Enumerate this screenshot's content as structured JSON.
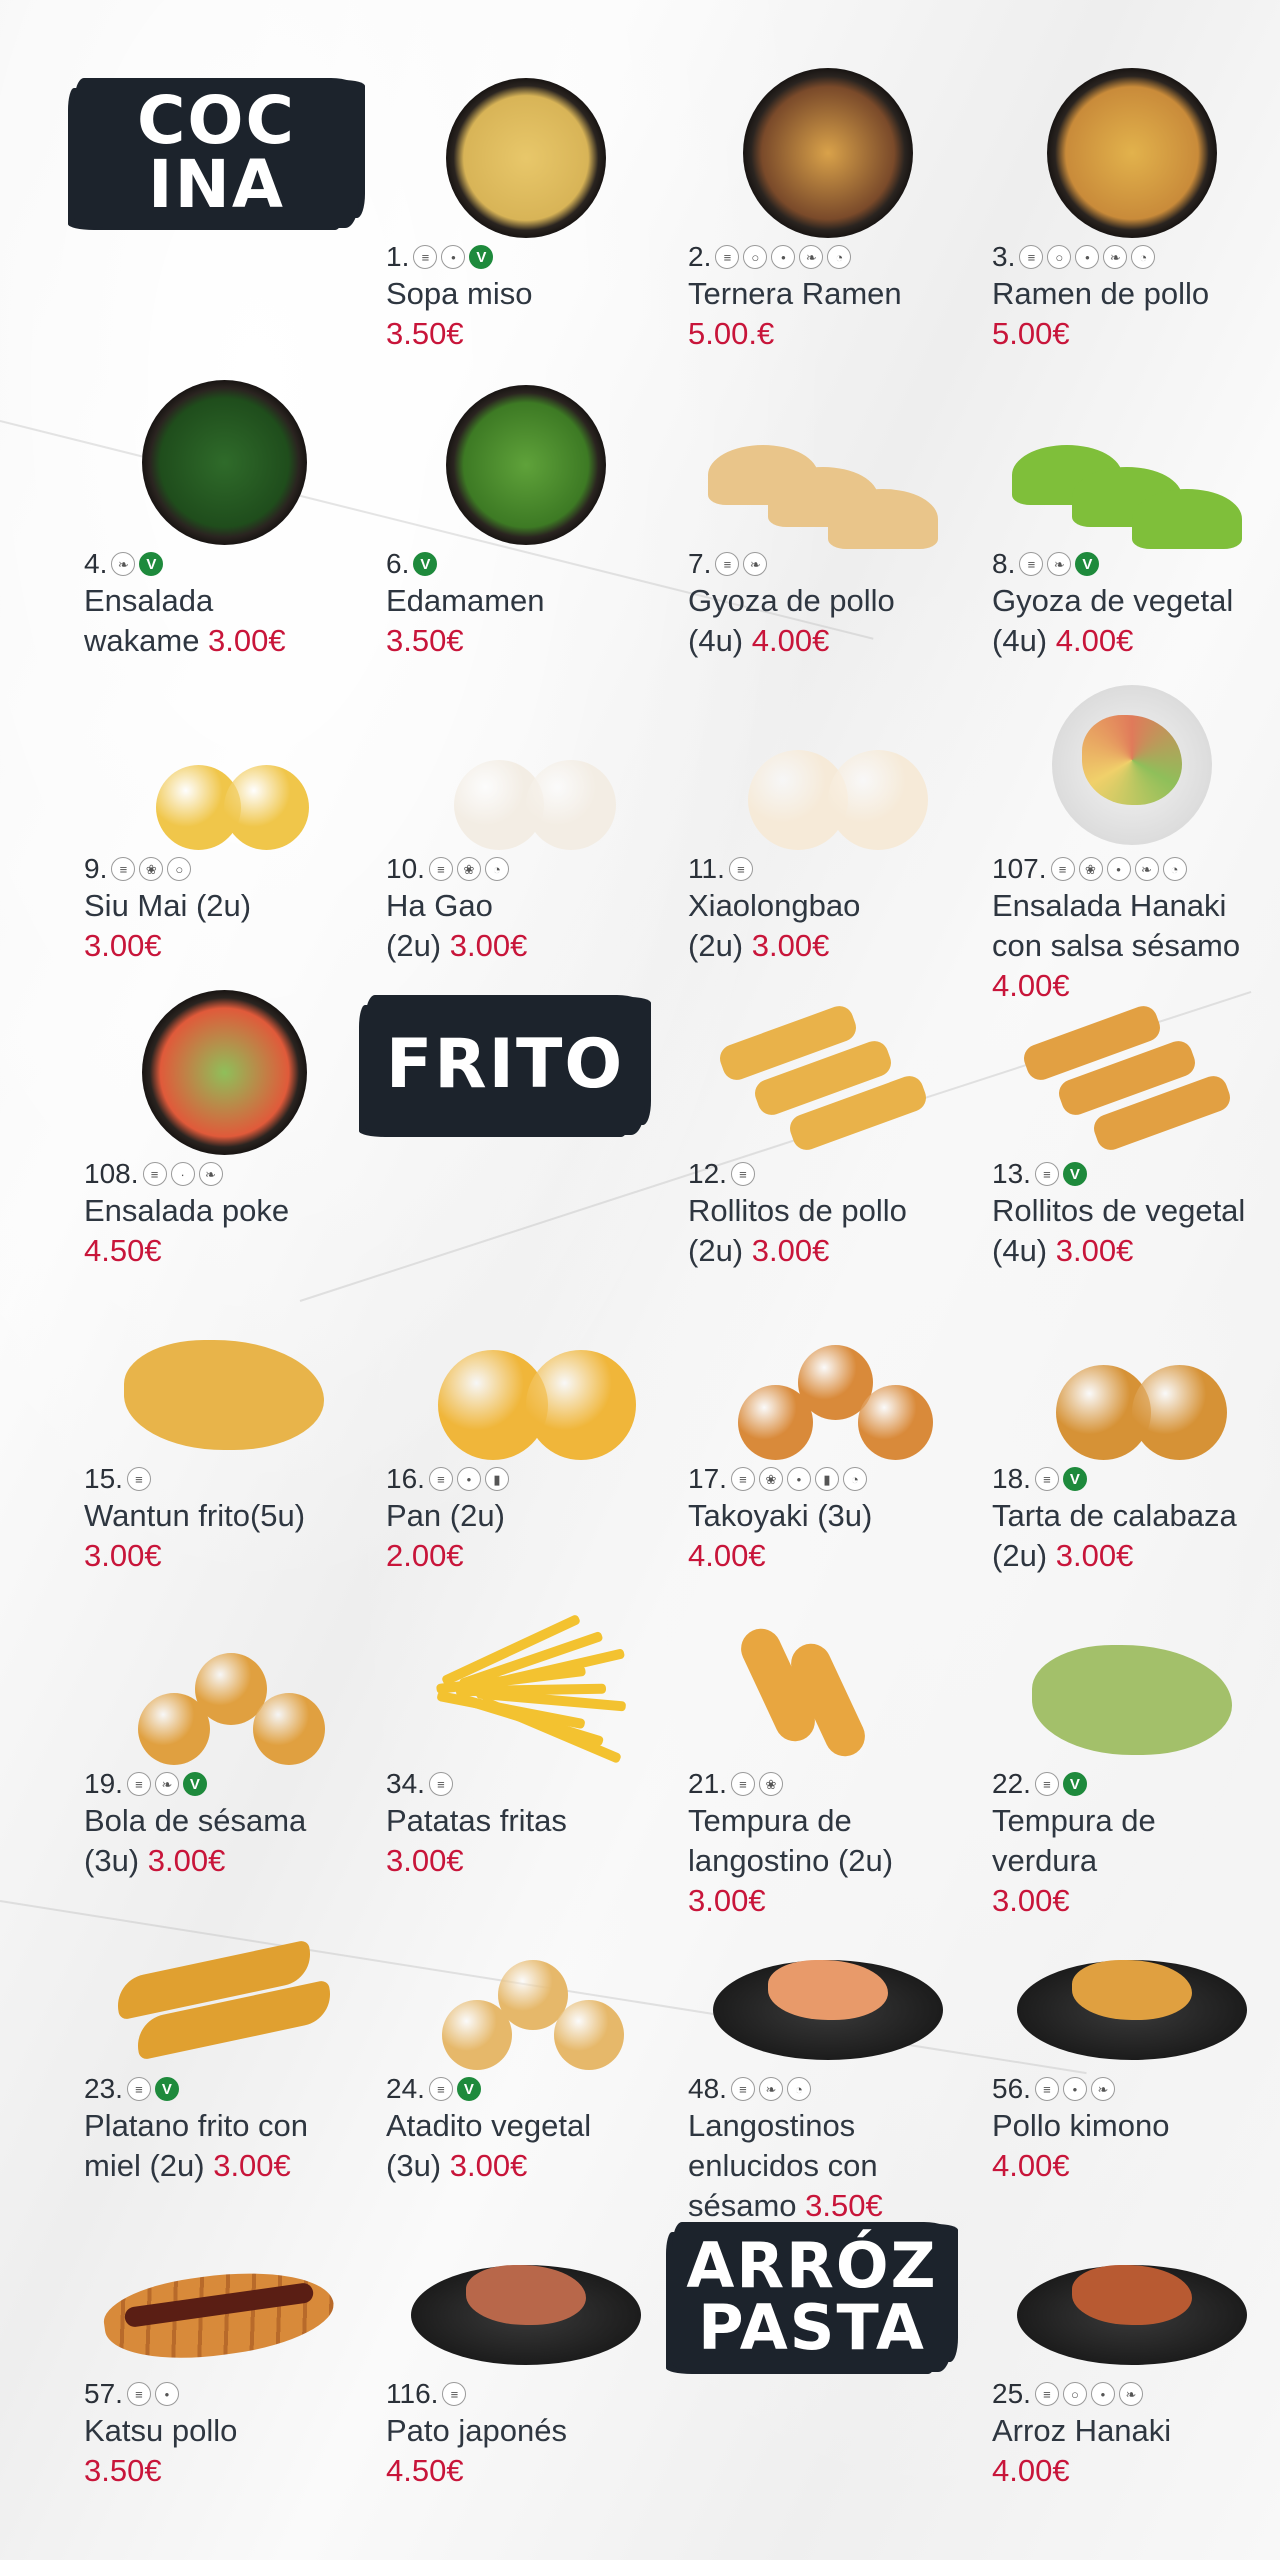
{
  "sections": {
    "cocina": "COC\nINA",
    "frito": "FRITO",
    "arroz": "ARRÓZ\nPASTA"
  },
  "icon_labels": {
    "wheat": "gluten-wheat-icon",
    "soy": "soy-icon",
    "egg": "egg-icon",
    "fish": "fish-icon",
    "crustacean": "crustacean-icon",
    "shellfish": "shellfish-icon",
    "sesame": "sesame-icon",
    "milk": "milk-icon",
    "vegan": "vegan-icon"
  },
  "items": [
    {
      "num": "1.",
      "name": "Sopa miso",
      "price": "3.50€",
      "icons": [
        "wheat",
        "soy",
        "vegan"
      ]
    },
    {
      "num": "2.",
      "name": "Ternera Ramen",
      "price": " 5.00.€",
      "icons": [
        "wheat",
        "egg",
        "soy",
        "fish",
        "shellfish"
      ]
    },
    {
      "num": "3.",
      "name": "Ramen de pollo",
      "price": "5.00€",
      "icons": [
        "wheat",
        "egg",
        "soy",
        "fish",
        "shellfish"
      ]
    },
    {
      "num": "4.",
      "name_lines": [
        "Ensalada",
        "wakame "
      ],
      "price": "3.00€",
      "icons": [
        "fish",
        "vegan"
      ]
    },
    {
      "num": "6.",
      "name": "Edamamen",
      "price": "3.50€",
      "icons": [
        "vegan"
      ]
    },
    {
      "num": "7.",
      "name_lines": [
        "Gyoza de pollo",
        "(4u) "
      ],
      "price": "4.00€",
      "icons": [
        "wheat",
        "fish"
      ]
    },
    {
      "num": "8.",
      "name_lines": [
        "Gyoza de vegetal",
        "(4u) "
      ],
      "price": "4.00€",
      "icons": [
        "wheat",
        "fish",
        "vegan"
      ]
    },
    {
      "num": "9.",
      "name": "Siu Mai (2u)",
      "price": "3.00€",
      "icons": [
        "wheat",
        "crustacean",
        "egg"
      ]
    },
    {
      "num": "10.",
      "name_lines": [
        "Ha Gao",
        "(2u) "
      ],
      "price": "3.00€",
      "icons": [
        "wheat",
        "crustacean",
        "shellfish"
      ]
    },
    {
      "num": "11.",
      "name_lines": [
        "Xiaolongbao",
        "(2u) "
      ],
      "price": "3.00€",
      "icons": [
        "wheat"
      ]
    },
    {
      "num": "107.",
      "name_lines": [
        "Ensalada Hanaki",
        "con salsa sésamo"
      ],
      "price": "4.00€",
      "icons": [
        "wheat",
        "crustacean",
        "soy",
        "fish",
        "shellfish"
      ]
    },
    {
      "num": "108.",
      "name": "Ensalada poke",
      "price": "4.50€",
      "icons": [
        "wheat",
        "sesame",
        "fish"
      ]
    },
    {
      "num": "12.",
      "name_lines": [
        "Rollitos de pollo",
        "(2u) "
      ],
      "price": "3.00€",
      "icons": [
        "wheat"
      ]
    },
    {
      "num": "13.",
      "name_lines": [
        "Rollitos de vegetal",
        "(4u) "
      ],
      "price": "3.00€",
      "icons": [
        "wheat",
        "vegan"
      ]
    },
    {
      "num": "15.",
      "name": "Wantun frito(5u)",
      "price": "3.00€",
      "icons": [
        "wheat"
      ]
    },
    {
      "num": "16.",
      "name": "Pan (2u)",
      "price": "2.00€",
      "icons": [
        "wheat",
        "soy",
        "milk"
      ]
    },
    {
      "num": "17.",
      "name": "Takoyaki (3u)",
      "price": "4.00€",
      "icons": [
        "wheat",
        "crustacean",
        "soy",
        "milk",
        "shellfish"
      ]
    },
    {
      "num": "18.",
      "name_lines": [
        "Tarta de calabaza",
        "(2u) "
      ],
      "price": "3.00€",
      "icons": [
        "wheat",
        "vegan"
      ]
    },
    {
      "num": "19.",
      "name_lines": [
        "Bola de sésama",
        "(3u) "
      ],
      "price": "3.00€",
      "icons": [
        "wheat",
        "fish",
        "vegan"
      ]
    },
    {
      "num": "34.",
      "name": "Patatas fritas",
      "price": "3.00€",
      "icons": [
        "wheat"
      ]
    },
    {
      "num": "21.",
      "name_lines": [
        "Tempura de",
        "langostino (2u)"
      ],
      "price": "3.00€",
      "icons": [
        "wheat",
        "crustacean"
      ]
    },
    {
      "num": "22.",
      "name_lines": [
        "Tempura de",
        "verdura"
      ],
      "price": "3.00€",
      "icons": [
        "wheat",
        "vegan"
      ]
    },
    {
      "num": "23.",
      "name_lines": [
        "Platano frito con",
        "miel (2u) "
      ],
      "price": "3.00€",
      "icons": [
        "wheat",
        "vegan"
      ]
    },
    {
      "num": "24.",
      "name_lines": [
        "Atadito vegetal",
        "(3u) "
      ],
      "price": "3.00€",
      "icons": [
        "wheat",
        "vegan"
      ]
    },
    {
      "num": "48.",
      "name_lines": [
        "Langostinos",
        "enlucidos con",
        "sésamo "
      ],
      "price": "3.50€",
      "icons": [
        "wheat",
        "fish",
        "shellfish"
      ]
    },
    {
      "num": "56.",
      "name": "Pollo kimono",
      "price": "4.00€",
      "icons": [
        "wheat",
        "soy",
        "fish"
      ]
    },
    {
      "num": "57.",
      "name": "Katsu pollo",
      "price": "3.50€",
      "icons": [
        "wheat",
        "soy"
      ]
    },
    {
      "num": "116.",
      "name": "Pato japonés",
      "price": "4.50€",
      "icons": [
        "wheat"
      ]
    },
    {
      "num": "25.",
      "name": "Arroz Hanaki",
      "price": "4.00€",
      "icons": [
        "wheat",
        "egg",
        "soy",
        "fish"
      ]
    }
  ]
}
